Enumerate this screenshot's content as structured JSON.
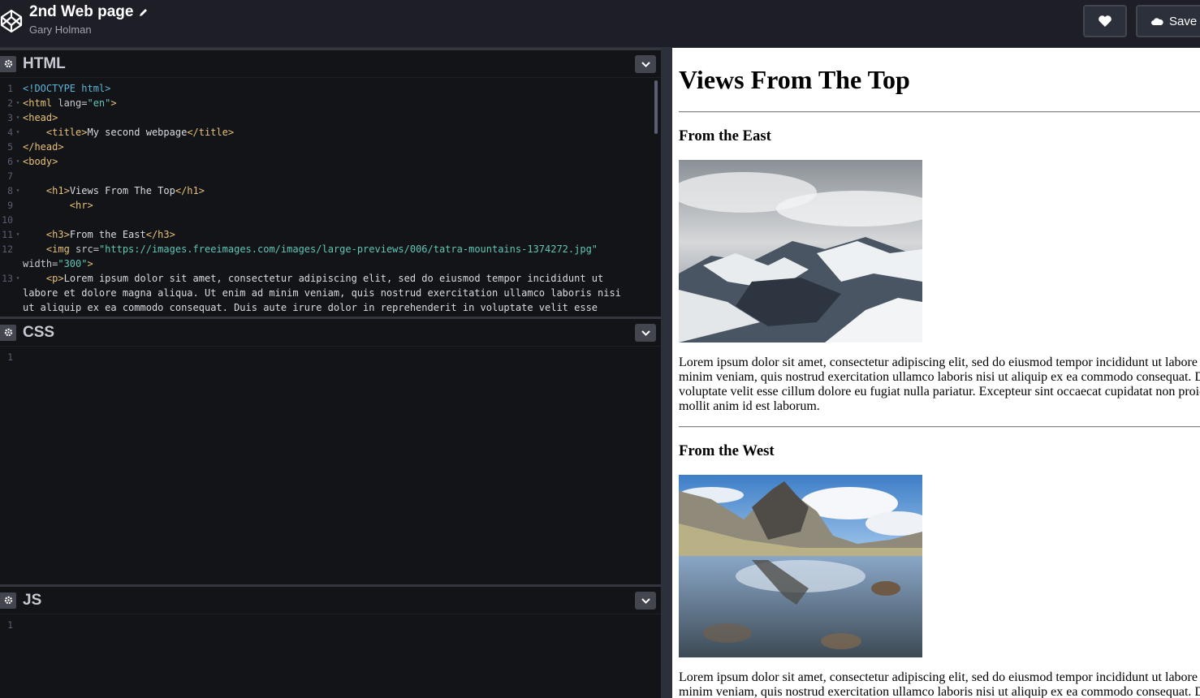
{
  "header": {
    "pen_title": "2nd Web page",
    "author": "Gary Holman",
    "save_label": "Save"
  },
  "panels": {
    "html": {
      "name": "HTML"
    },
    "css": {
      "name": "CSS",
      "lines": [
        "1"
      ]
    },
    "js": {
      "name": "JS",
      "lines": [
        "1"
      ]
    }
  },
  "html_code": {
    "l1": "<!DOCTYPE html>",
    "l2a": "<html ",
    "l2b": "lang=",
    "l2c": "\"en\"",
    "l2d": ">",
    "l3": "<head>",
    "l4a": "    <title>",
    "l4b": "My second webpage",
    "l4c": "</title>",
    "l5": "</head>",
    "l6": "<body>",
    "l8a": "    <h1>",
    "l8b": "Views From The Top",
    "l8c": "</h1>",
    "l9": "        <hr>",
    "l11a": "    <h3>",
    "l11b": "From the East",
    "l11c": "</h3>",
    "l12a": "    <img ",
    "l12b": "src=",
    "l12c": "\"https://images.freeimages.com/images/large-previews/006/tatra-mountains-1374272.jpg\"",
    "l12d": "width=",
    "l12e": "\"300\"",
    "l12f": ">",
    "l13a": "    <p>",
    "l13b": "Lorem ipsum dolor sit amet, consectetur adipiscing elit, sed do eiusmod tempor incididunt ut labore et dolore magna aliqua. Ut enim ad minim veniam, quis nostrud exercitation ullamco laboris nisi ut aliquip ex ea commodo consequat. Duis aute irure dolor in reprehenderit in voluptate velit esse"
  },
  "preview": {
    "h1": "Views From The Top",
    "sections": [
      {
        "heading": "From the East",
        "image_alt": "tatra-mountains",
        "paragraph": "Lorem ipsum dolor sit amet, consectetur adipiscing elit, sed do eiusmod tempor incididunt ut labore et dolore magna aliqua. Ut enim ad minim veniam, quis nostrud exercitation ullamco laboris nisi ut aliquip ex ea commodo consequat. Duis aute irure dolor in reprehenderit in voluptate velit esse cillum dolore eu fugiat nulla pariatur. Excepteur sint occaecat cupidatat non proident, sunt in culpa qui officia deserunt mollit anim id est laborum."
      },
      {
        "heading": "From the West",
        "image_alt": "mountain-lake",
        "paragraph": "Lorem ipsum dolor sit amet, consectetur adipiscing elit, sed do eiusmod tempor incididunt ut labore et dolore magna aliqua. Ut enim ad minim veniam, quis nostrud exercitation ullamco laboris nisi ut aliquip ex ea commodo consequat. Duis aute irure dolor in reprehenderit in voluptate velit esse cillum dolore eu fugiat nulla pariatur."
      }
    ]
  },
  "colors": {
    "topbar_bg": "#1e1f26",
    "editor_bg": "#131417",
    "tag": "#e6c07b",
    "string": "#61c4b4",
    "doctype": "#5fb3d9"
  },
  "icons": [
    "codepen-logo-icon",
    "pencil-icon",
    "heart-icon",
    "cloud-icon",
    "gear-icon",
    "chevron-down-icon"
  ]
}
